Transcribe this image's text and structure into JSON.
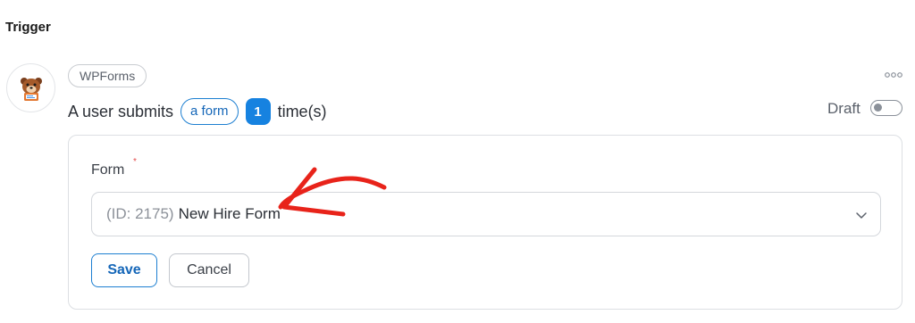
{
  "section": {
    "title": "Trigger"
  },
  "integration": {
    "name": "WPForms",
    "icon": "wpforms-bear-logo"
  },
  "sentence": {
    "prefix": "A user submits",
    "form_chip": "a form",
    "count": "1",
    "suffix": "time(s)"
  },
  "status": {
    "label": "Draft",
    "enabled": false
  },
  "form_field": {
    "label": "Form",
    "required_mark": "*",
    "selected_id": "(ID: 2175)",
    "selected_name": "New Hire Form"
  },
  "actions": {
    "save": "Save",
    "cancel": "Cancel"
  },
  "colors": {
    "accent": "#1682e0",
    "accent_text": "#1466b8",
    "annotation": "#e8231a",
    "required": "#e34b4b"
  }
}
